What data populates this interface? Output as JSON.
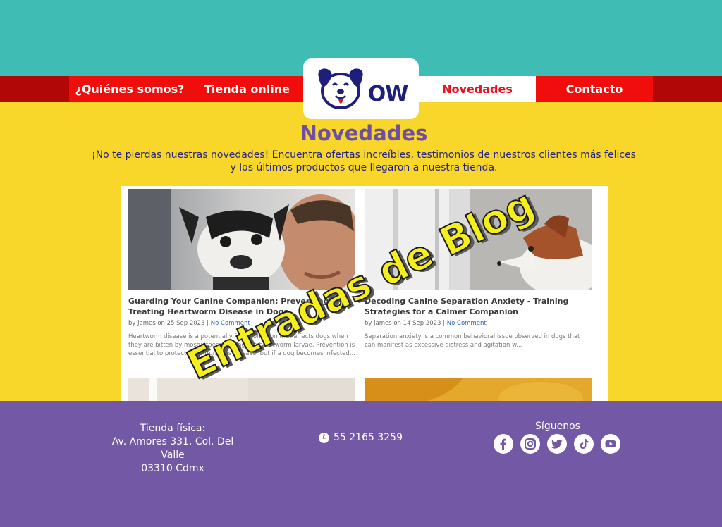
{
  "nav": {
    "about": "¿Quiénes somos?",
    "shop": "Tienda online",
    "news": "Novedades",
    "contact": "Contacto"
  },
  "logo": {
    "text": "OW"
  },
  "main": {
    "title": "Novedades",
    "intro_line1": "¡No te pierdas nuestras novedades! Encuentra ofertas increíbles, testimonios de nuestros clientes más felices",
    "intro_line2": "y los últimos productos que llegaron a nuestra tienda."
  },
  "posts": [
    {
      "title_line1": "Guarding Your Canine Companion: Preventing and",
      "title_line2": "Treating Heartworm Disease in Dogs",
      "author_date": "by james on 25 Sep 2023 |",
      "comments": "No Comment",
      "excerpt": "Heartworm disease is a potentially fatal condition that affects dogs when they are bitten by mosquitoes carrying the heartworm larvae. Prevention is essential to protect dogs from this disease, but if a dog becomes infected..."
    },
    {
      "title_line1": "Decoding Canine Separation Anxiety - Training",
      "title_line2": "Strategies for a Calmer Companion",
      "author_date": "by james on 14 Sep 2023 |",
      "comments": "No Comment",
      "excerpt": "Separation anxiety is a common behavioral issue observed in dogs that can manifest as excessive distress and agitation w..."
    }
  ],
  "overlay": {
    "text": "Entradas de Blog"
  },
  "footer": {
    "store_label": "Tienda física:",
    "address_line1": "Av. Amores 331, Col. Del Valle",
    "address_line2": "03310 Cdmx",
    "phone": "55 2165 3259",
    "follow": "Síguenos",
    "socials": [
      "facebook-icon",
      "instagram-icon",
      "twitter-icon",
      "tiktok-icon",
      "youtube-icon"
    ]
  },
  "colors": {
    "teal": "#3fbdb5",
    "yellow": "#f9d62a",
    "red": "#f20d0d",
    "dark_red": "#b10707",
    "purple": "#7358a5",
    "title_purple": "#6e4fa3",
    "navy": "#232287"
  }
}
